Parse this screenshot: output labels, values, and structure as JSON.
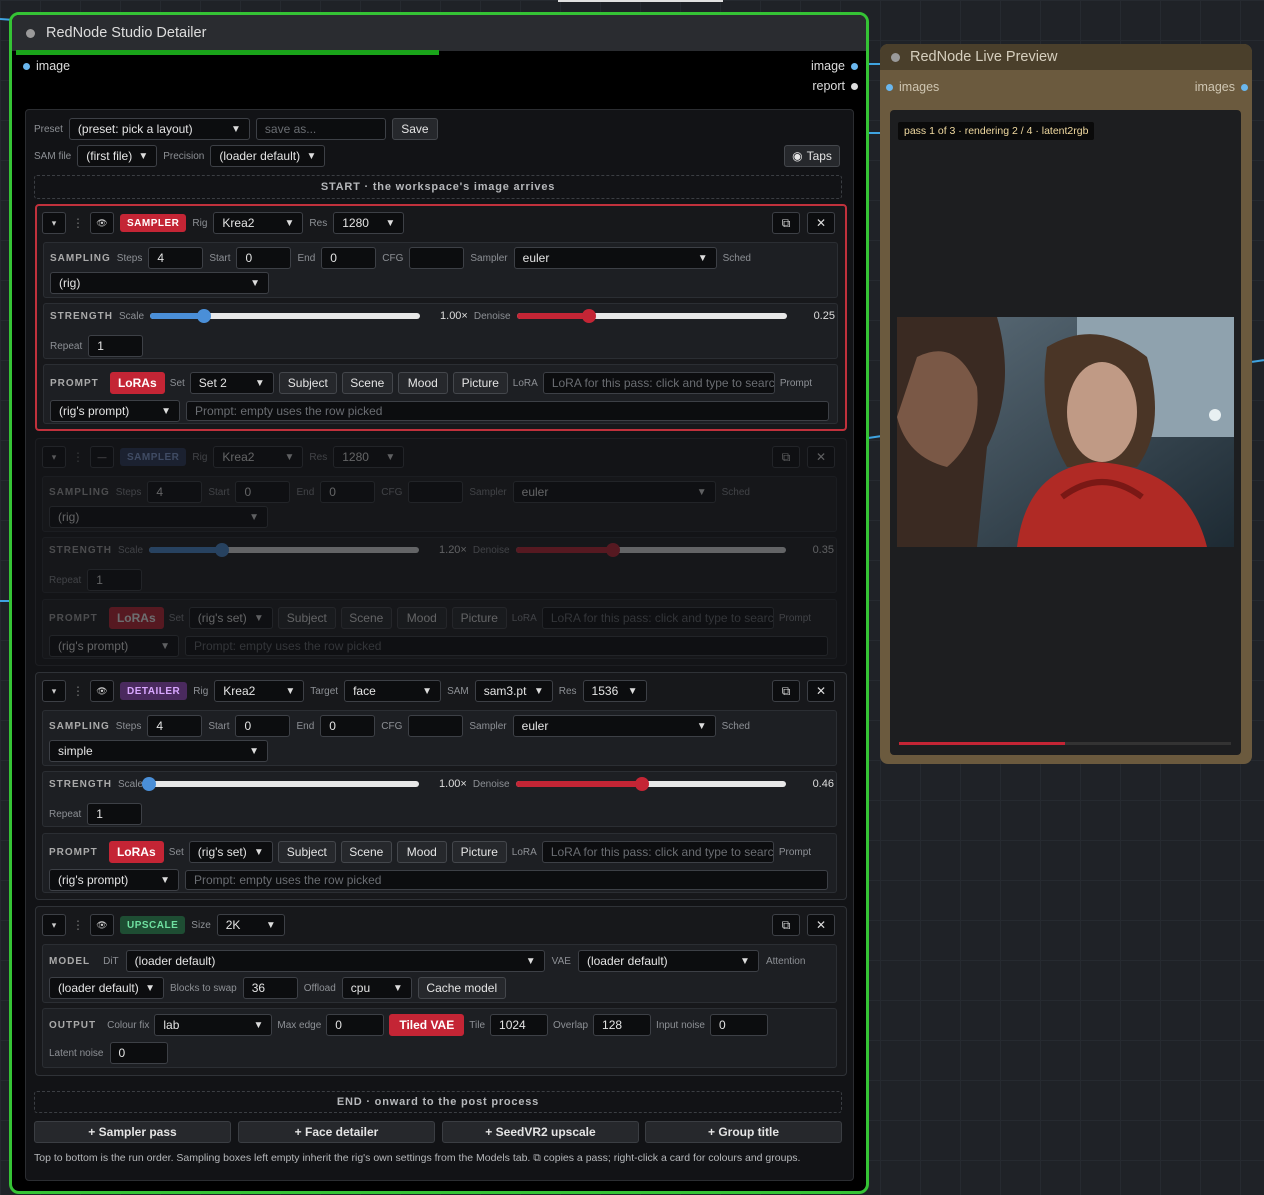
{
  "main_node": {
    "title": "RedNode Studio Detailer",
    "input_image": "image",
    "output_image": "image",
    "output_report": "report"
  },
  "toolbar": {
    "preset_label": "Preset",
    "preset_value": "(preset: pick a layout)",
    "save_as_placeholder": "save as...",
    "save_label": "Save",
    "sam_file_label": "SAM file",
    "sam_file_value": "(first file)",
    "precision_label": "Precision",
    "precision_value": "(loader default)",
    "taps_label": "Taps"
  },
  "start_label": "START · the workspace's image arrives",
  "end_label": "END · onward to the post process",
  "common": {
    "rig": "Rig",
    "res": "Res",
    "sampling": "SAMPLING",
    "steps": "Steps",
    "start": "Start",
    "end": "End",
    "cfg": "CFG",
    "sampler": "Sampler",
    "sched": "Sched",
    "strength": "STRENGTH",
    "scale": "Scale",
    "denoise": "Denoise",
    "repeat": "Repeat",
    "prompt_sec": "PROMPT",
    "loras": "LoRAs",
    "set": "Set",
    "subject": "Subject",
    "scene": "Scene",
    "mood": "Mood",
    "picture": "Picture",
    "lora": "LoRA",
    "prompt_lbl": "Prompt",
    "lora_placeholder": "LoRA for this pass: click and type to search",
    "prompt_placeholder": "Prompt: empty uses the row picked",
    "target": "Target",
    "sam": "SAM"
  },
  "cards": [
    {
      "type": "SAMPLER",
      "rig": "Krea2",
      "res": "1280",
      "steps": "4",
      "start": "0",
      "end": "0",
      "cfg": "",
      "sampler": "euler",
      "sched": "(rig)",
      "scale_text": "1.00×",
      "scale": 0.2,
      "denoise_text": "0.25",
      "denoise": 0.27,
      "repeat": "1",
      "set": "Set 2",
      "prompt_row": "(rig's prompt)"
    },
    {
      "type": "SAMPLER",
      "rig": "Krea2",
      "res": "1280",
      "steps": "4",
      "start": "0",
      "end": "0",
      "cfg": "",
      "sampler": "euler",
      "sched": "(rig)",
      "scale_text": "1.20×",
      "scale": 0.27,
      "denoise_text": "0.35",
      "denoise": 0.36,
      "repeat": "1",
      "set": "(rig's set)",
      "prompt_row": "(rig's prompt)"
    },
    {
      "type": "DETAILER",
      "rig": "Krea2",
      "res": "1536",
      "target": "face",
      "sam": "sam3.pt",
      "steps": "4",
      "start": "0",
      "end": "0",
      "cfg": "",
      "sampler": "euler",
      "sched": "simple",
      "scale_text": "1.00×",
      "scale": 0.0,
      "denoise_text": "0.46",
      "denoise": 0.47,
      "repeat": "1",
      "set": "(rig's set)",
      "prompt_row": "(rig's prompt)"
    }
  ],
  "upscale": {
    "type": "UPSCALE",
    "size_label": "Size",
    "size": "2K",
    "model_sec": "MODEL",
    "dit_label": "DiT",
    "dit": "(loader default)",
    "vae_label": "VAE",
    "vae": "(loader default)",
    "attention_label": "Attention",
    "attention": "(loader default)",
    "blocks_label": "Blocks to swap",
    "blocks": "36",
    "offload_label": "Offload",
    "offload": "cpu",
    "cache_label": "Cache model",
    "output_sec": "OUTPUT",
    "colour_label": "Colour fix",
    "colour": "lab",
    "max_edge_label": "Max edge",
    "max_edge": "0",
    "tiled_vae": "Tiled VAE",
    "tile_label": "Tile",
    "tile": "1024",
    "overlap_label": "Overlap",
    "overlap": "128",
    "input_noise_label": "Input noise",
    "input_noise": "0",
    "latent_noise_label": "Latent noise",
    "latent_noise": "0"
  },
  "add_buttons": [
    "+ Sampler pass",
    "+ Face detailer",
    "+ SeedVR2 upscale",
    "+ Group title"
  ],
  "footer": "Top to bottom is the run order. Sampling boxes left empty inherit the rig's own settings from the Models tab. ⧉ copies a pass; right-click a card for colours and groups.",
  "preview_node": {
    "title": "RedNode Live Preview",
    "input_images": "images",
    "output_images": "images",
    "status": "pass 1 of 3 · rendering 2 / 4 · latent2rgb",
    "progress": 0.5
  },
  "colors": {
    "node_border": "#35c335",
    "accent_red": "#c42535",
    "wire": "#3fa3e0",
    "preview_frame": "#6b5a3e"
  }
}
